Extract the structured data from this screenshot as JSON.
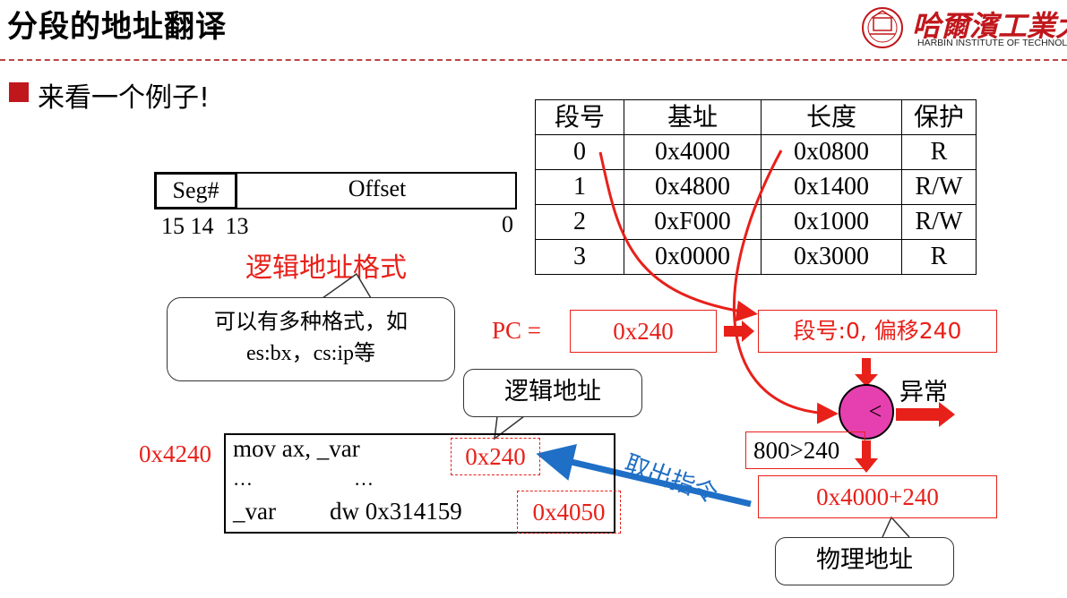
{
  "title": "分段的地址翻译",
  "logo": {
    "cn_name": "哈爾濱工業大学",
    "en_name": "HARBIN INSTITUTE OF TECHNOLOGY",
    "seal_text": "1920 H.I.T"
  },
  "bullet": "来看一个例子!",
  "segment_table": {
    "headers": [
      "段号",
      "基址",
      "长度",
      "保护"
    ],
    "rows": [
      [
        "0",
        "0x4000",
        "0x0800",
        "R"
      ],
      [
        "1",
        "0x4800",
        "0x1400",
        "R/W"
      ],
      [
        "2",
        "0xF000",
        "0x1000",
        "R/W"
      ],
      [
        "3",
        "0x0000",
        "0x3000",
        "R"
      ]
    ]
  },
  "logical_format": {
    "seg_field": "Seg#",
    "offset_field": "Offset",
    "bits_left": "15 14  13",
    "bits_right": "0",
    "caption": "逻辑地址格式"
  },
  "callout_formats": {
    "line1": "可以有多种格式，如",
    "line2": "es:bx，cs:ip等"
  },
  "pc": {
    "label": "PC =",
    "value": "0x240",
    "decoded": "段号:0, 偏移240"
  },
  "compare": {
    "symbol": "<",
    "exception": "异常",
    "check": "800>240",
    "physical_calc": "0x4000+240",
    "physical_label": "物理地址"
  },
  "fetch_label": "取出指令",
  "logical_label": "逻辑地址",
  "memory": {
    "start_addr": "0x4240",
    "line1": "mov ax, _var",
    "line2_left": "…",
    "line2_right": "…",
    "line3_label": "_var",
    "line3_instr": "dw 0x314159",
    "var_offset": "0x240",
    "var_address": "0x4050"
  },
  "colors": {
    "accent_red": "#e8201a",
    "brand_red": "#c0171c",
    "fetch_blue": "#1f6fc6",
    "compare_fill": "#e63fb0"
  }
}
